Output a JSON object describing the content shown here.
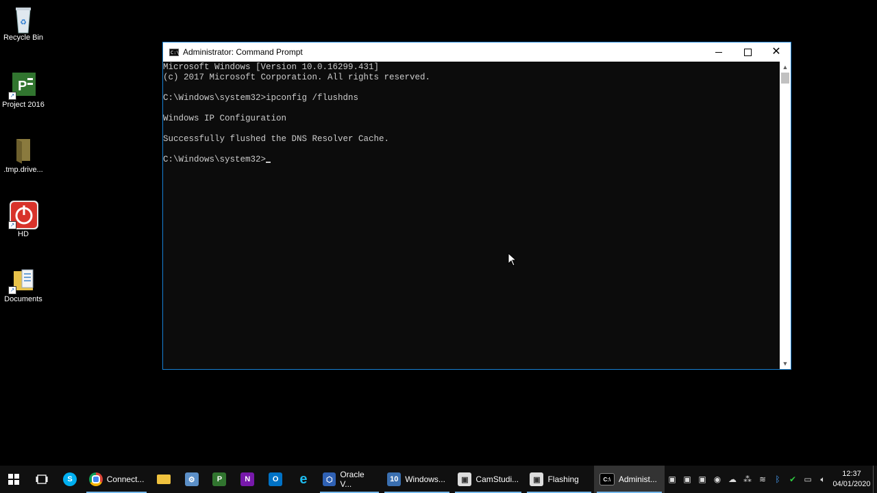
{
  "desktop": {
    "icons": [
      {
        "label": "Recycle Bin",
        "icon": "recycle-bin-icon"
      },
      {
        "label": "Project 2016",
        "icon": "project-icon"
      },
      {
        "label": ".tmp.drive...",
        "icon": "folder-icon"
      },
      {
        "label": "HD",
        "icon": "power-icon"
      },
      {
        "label": "Documents",
        "icon": "documents-icon"
      }
    ]
  },
  "window": {
    "title": "Administrator: Command Prompt",
    "close_glyph": "✕",
    "console_lines": [
      "Microsoft Windows [Version 10.0.16299.431]",
      "(c) 2017 Microsoft Corporation. All rights reserved.",
      "",
      "C:\\Windows\\system32>ipconfig /flushdns",
      "",
      "Windows IP Configuration",
      "",
      "Successfully flushed the DNS Resolver Cache.",
      "",
      "C:\\Windows\\system32>"
    ],
    "scroll_up": "▲",
    "scroll_down": "▼"
  },
  "taskbar": {
    "apps": [
      {
        "label": "Connect...",
        "icon": "chrome-icon"
      },
      {
        "label": "Oracle V...",
        "icon": "virtualbox-icon"
      },
      {
        "label": "Windows...",
        "icon": "windows-installer-icon"
      },
      {
        "label": "CamStudi...",
        "icon": "camstudio-icon"
      },
      {
        "label": "Flashing",
        "icon": "camstudio-icon"
      },
      {
        "label": "Administ...",
        "icon": "cmd-icon"
      }
    ],
    "pinned": [
      "file-explorer-icon",
      "network-icon",
      "project-icon",
      "onenote-icon",
      "outlook-icon",
      "internet-explorer-icon"
    ],
    "tray_icons": [
      "camstudio-icon",
      "camstudio-icon",
      "camstudio-icon",
      "chrome-icon",
      "onedrive-icon",
      "network-status-icon",
      "wifi-icon",
      "bluetooth-icon",
      "defender-icon",
      "battery-icon",
      "volume-icon"
    ],
    "clock": {
      "time": "12:37",
      "date": "04/01/2020"
    }
  }
}
